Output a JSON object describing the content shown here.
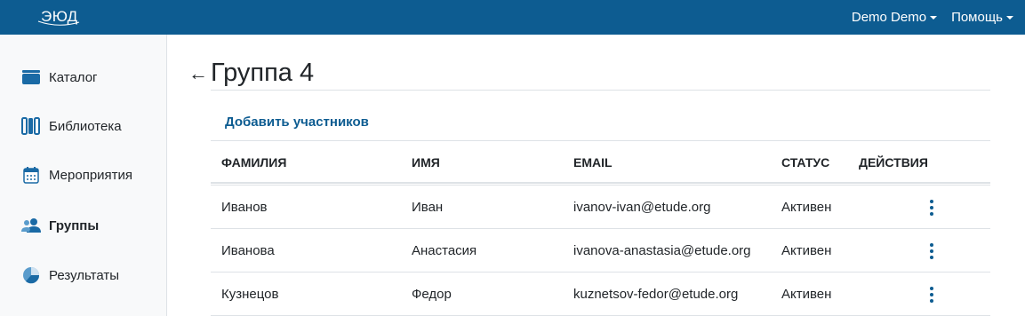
{
  "header": {
    "logo_text": "ЭЮД",
    "user_menu": "Demo Demo",
    "help_menu": "Помощь",
    "bar_color": "#0d5c91"
  },
  "sidebar": {
    "items": [
      {
        "label": "Каталог",
        "icon": "catalog-icon"
      },
      {
        "label": "Библиотека",
        "icon": "library-icon"
      },
      {
        "label": "Мероприятия",
        "icon": "calendar-icon"
      },
      {
        "label": "Группы",
        "icon": "users-icon",
        "active": true
      },
      {
        "label": "Результаты",
        "icon": "pie-chart-icon"
      }
    ]
  },
  "main": {
    "back_symbol": "←",
    "title": "Группа 4",
    "add_members": "Добавить участников",
    "table": {
      "columns": [
        "ФАМИЛИЯ",
        "ИМЯ",
        "EMAIL",
        "СТАТУС",
        "ДЕЙСТВИЯ"
      ],
      "rows": [
        {
          "last_name": "Иванов",
          "first_name": "Иван",
          "email": "ivanov-ivan@etude.org",
          "status": "Активен"
        },
        {
          "last_name": "Иванова",
          "first_name": "Анастасия",
          "email": "ivanova-anastasia@etude.org",
          "status": "Активен"
        },
        {
          "last_name": "Кузнецов",
          "first_name": "Федор",
          "email": "kuznetsov-fedor@etude.org",
          "status": "Активен"
        }
      ]
    }
  }
}
